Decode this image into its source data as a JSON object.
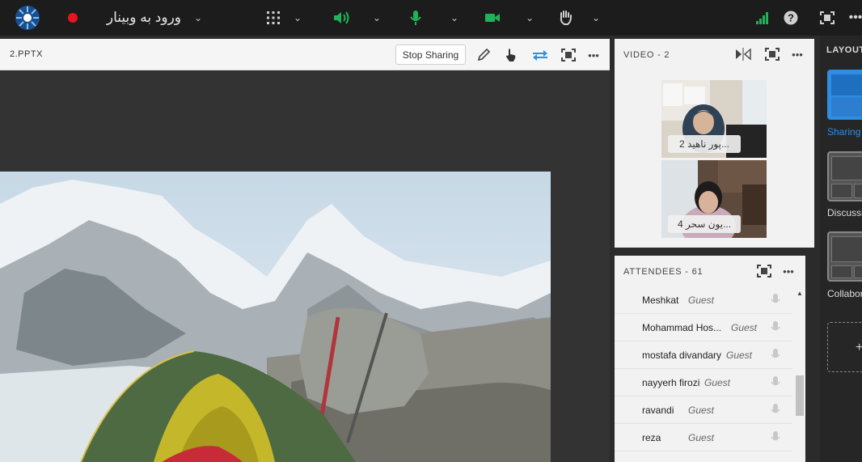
{
  "topbar": {
    "meeting_title": "ورود به وبینار",
    "icons": [
      "connect-logo",
      "record-dot",
      "apps-grid",
      "speaker",
      "microphone",
      "camera",
      "raise-hand",
      "signal",
      "help",
      "fullscreen",
      "more"
    ]
  },
  "share": {
    "title": "2.PPTX",
    "stop_label": "Stop Sharing"
  },
  "video": {
    "title": "VIDEO  - 2",
    "tiles": [
      {
        "label": "...پور ناهید 2"
      },
      {
        "label": "...یون سحر 4"
      }
    ]
  },
  "attendees": {
    "title": "ATTENDEES  - 61",
    "rows": [
      {
        "name": "Meshkat",
        "role": "Guest"
      },
      {
        "name": "Mohammad Hos...",
        "role": "Guest"
      },
      {
        "name": "mostafa divandary",
        "role": "Guest"
      },
      {
        "name": "nayyerh firozi",
        "role": "Guest"
      },
      {
        "name": "ravandi",
        "role": "Guest"
      },
      {
        "name": "reza",
        "role": "Guest"
      }
    ]
  },
  "layouts": {
    "title": "LAYOUT",
    "items": [
      {
        "label": "Sharing"
      },
      {
        "label": "Discussi"
      },
      {
        "label": "Collabor"
      }
    ]
  },
  "colors": {
    "accent": "#1fb35a",
    "record": "#e5151f",
    "share_blue": "#2f8de4"
  }
}
